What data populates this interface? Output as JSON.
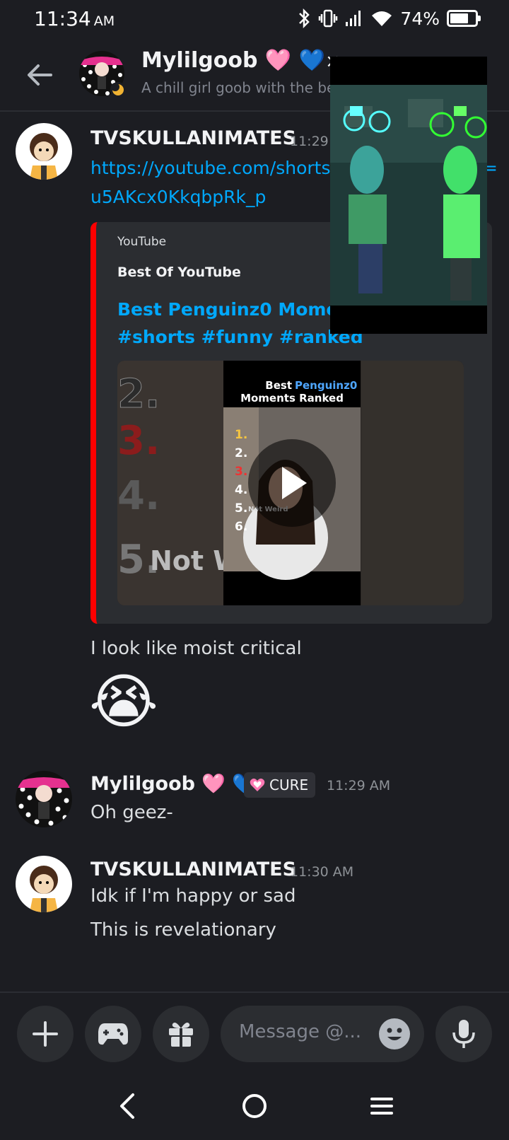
{
  "status_bar": {
    "time": "11:34",
    "ampm": "AM",
    "battery_percent": "74%",
    "battery_level": 0.74
  },
  "header": {
    "title": "Mylilgoob 🩷 💙",
    "subtitle": "A chill girl goob with the be",
    "close_glyph": "×"
  },
  "messages": [
    {
      "username": "TVSKULLANIMATES",
      "time": "11:29 A",
      "link_line1": "https://youtube.com/shorts",
      "link_line1_tail": "=",
      "link_line2": "u5AKcx0KkqbpRk_p",
      "embed": {
        "provider": "YouTube",
        "author": "Best Of YouTube",
        "title_line1": "Best Penguinz0 Moment",
        "title_line2": "#shorts #funny #ranked",
        "thumb_text": {
          "heading_word1": "Best",
          "heading_word2": "Penguinz0",
          "heading_line2": "Moments Ranked",
          "list": [
            "1.",
            "2.",
            "3.",
            "4.",
            "5.",
            "6."
          ],
          "list_item5": "Not Weird",
          "bg_numbers": [
            "2.",
            "3.",
            "4.",
            "5."
          ],
          "bg_text": "Not W"
        }
      },
      "text": "I look like moist critical",
      "emoji": "😭"
    },
    {
      "username": "Mylilgoob 🩷 💙",
      "badge": "CURE",
      "time": "11:29 AM",
      "text": "Oh geez-"
    },
    {
      "username": "TVSKULLANIMATES",
      "time": "11:30 AM",
      "text1": "Idk if I'm happy or sad",
      "text2": "This is revelationary"
    }
  ],
  "composer": {
    "placeholder": "Message @..."
  },
  "colors": {
    "background": "#1c1d22",
    "link": "#00a8fc",
    "embed_bar": "#ff0000",
    "badge_bg": "#2f3036"
  },
  "icons": [
    "back-arrow-icon",
    "plus-icon",
    "gamepad-icon",
    "gift-icon",
    "emoji-icon",
    "microphone-icon",
    "nav-back-icon",
    "nav-home-icon",
    "nav-menu-icon",
    "bluetooth-icon",
    "vibrate-icon",
    "signal-icon",
    "wifi-icon",
    "battery-icon"
  ]
}
